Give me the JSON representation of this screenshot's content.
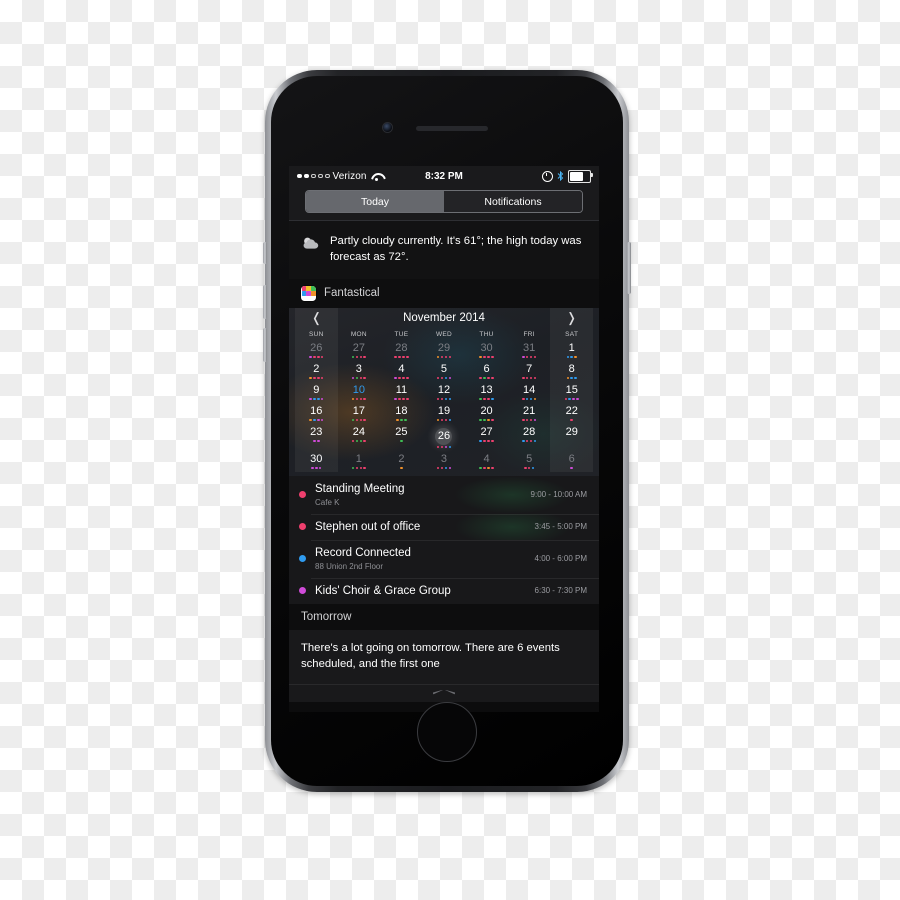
{
  "status_bar": {
    "carrier": "Verizon",
    "signal_filled": 2,
    "signal_total": 5,
    "wifi_icon": "wifi-icon",
    "time": "8:32 PM",
    "alarm_icon": "alarm-icon",
    "bluetooth_icon": "bluetooth-icon",
    "battery_icon": "battery-icon",
    "battery_level": 68
  },
  "segmented": {
    "today_label": "Today",
    "notifications_label": "Notifications",
    "selected": "Today"
  },
  "weather": {
    "icon": "partly-cloudy-icon",
    "text": "Partly cloudy currently. It's 61°; the high today was forecast as 72°."
  },
  "fantastical": {
    "app_icon": "fantastical-icon",
    "title": "Fantastical",
    "calendar": {
      "prev_label": "❬",
      "next_label": "❭",
      "month_label": "November 2014",
      "weekdays": [
        "SUN",
        "MON",
        "TUE",
        "WED",
        "THU",
        "FRI",
        "SAT"
      ],
      "today": 26,
      "highlight_blue": 10,
      "weeks": [
        [
          {
            "n": "26",
            "dim": true,
            "dots": [
              "#cf4bd8",
              "#ef3f6e",
              "#ef3f6e",
              "#ef3f6e"
            ]
          },
          {
            "n": "27",
            "dim": true,
            "dots": [
              "#3fbf55",
              "#ef3f6e",
              "#ef3f6e",
              "#ef3f6e"
            ]
          },
          {
            "n": "28",
            "dim": true,
            "dots": [
              "#ef3f6e",
              "#ef3f6e",
              "#ef3f6e",
              "#ef3f6e"
            ]
          },
          {
            "n": "29",
            "dim": true,
            "dots": [
              "#f0902a",
              "#ef3f6e",
              "#ef3f6e",
              "#ef3f6e"
            ]
          },
          {
            "n": "30",
            "dim": true,
            "dots": [
              "#f0902a",
              "#ef3f6e",
              "#ef3f6e",
              "#ef3f6e"
            ]
          },
          {
            "n": "31",
            "dim": true,
            "dots": [
              "#cf4bd8",
              "#ef3f6e",
              "#ef3f6e",
              "#ef3f6e"
            ]
          },
          {
            "n": "1",
            "dim": false,
            "dots": [
              "#2f9bef",
              "#2f9bef",
              "#f0902a"
            ]
          }
        ],
        [
          {
            "n": "2",
            "dim": false,
            "dots": [
              "#f0902a",
              "#ef3f6e",
              "#ef3f6e",
              "#ef3f6e"
            ]
          },
          {
            "n": "3",
            "dim": false,
            "dots": [
              "#cf4bd8",
              "#3fbf55",
              "#ef3f6e",
              "#ef3f6e"
            ]
          },
          {
            "n": "4",
            "dim": false,
            "dots": [
              "#cf4bd8",
              "#ef3f6e",
              "#ef3f6e",
              "#ef3f6e"
            ]
          },
          {
            "n": "5",
            "dim": false,
            "dots": [
              "#ef3f6e",
              "#ef3f6e",
              "#2f9bef",
              "#cf4bd8"
            ]
          },
          {
            "n": "6",
            "dim": false,
            "dots": [
              "#ef3f6e",
              "#3fbf55",
              "#ef3f6e",
              "#ef3f6e"
            ]
          },
          {
            "n": "7",
            "dim": false,
            "dots": [
              "#ef3f6e",
              "#ef3f6e",
              "#ef3f6e",
              "#ef3f6e"
            ]
          },
          {
            "n": "8",
            "dim": false,
            "dots": [
              "#f0902a",
              "#2f9bef",
              "#2f9bef"
            ]
          }
        ],
        [
          {
            "n": "9",
            "dim": false,
            "dots": [
              "#cf4bd8",
              "#2f9bef",
              "#2f9bef",
              "#cf4bd8"
            ]
          },
          {
            "n": "10",
            "dim": false,
            "blue": true,
            "dots": [
              "#f0902a",
              "#ef3f6e",
              "#ef3f6e",
              "#ef3f6e"
            ]
          },
          {
            "n": "11",
            "dim": false,
            "dots": [
              "#cf4bd8",
              "#ef3f6e",
              "#ef3f6e",
              "#ef3f6e"
            ]
          },
          {
            "n": "12",
            "dim": false,
            "dots": [
              "#ef3f6e",
              "#ef3f6e",
              "#2f9bef",
              "#2f9bef"
            ]
          },
          {
            "n": "13",
            "dim": false,
            "dots": [
              "#3fbf55",
              "#ef3f6e",
              "#ef3f6e",
              "#2f9bef"
            ]
          },
          {
            "n": "14",
            "dim": false,
            "dots": [
              "#ef3f6e",
              "#2f9bef",
              "#2f9bef",
              "#f0902a"
            ]
          },
          {
            "n": "15",
            "dim": false,
            "dots": [
              "#ef3f6e",
              "#2f9bef",
              "#cf4bd8",
              "#cf4bd8"
            ]
          }
        ],
        [
          {
            "n": "16",
            "dim": false,
            "dots": [
              "#f0902a",
              "#2f9bef",
              "#cf4bd8",
              "#cf4bd8"
            ]
          },
          {
            "n": "17",
            "dim": false,
            "dots": [
              "#3fbf55",
              "#ef3f6e",
              "#ef3f6e",
              "#ef3f6e"
            ]
          },
          {
            "n": "18",
            "dim": false,
            "dots": [
              "#f0902a",
              "#3fbf55",
              "#3fbf55"
            ]
          },
          {
            "n": "19",
            "dim": false,
            "dots": [
              "#f0902a",
              "#ef3f6e",
              "#ef3f6e",
              "#2f9bef"
            ]
          },
          {
            "n": "20",
            "dim": false,
            "dots": [
              "#3fbf55",
              "#3fbf55",
              "#f0902a",
              "#ef3f6e"
            ]
          },
          {
            "n": "21",
            "dim": false,
            "dots": [
              "#ef3f6e",
              "#ef3f6e",
              "#ef3f6e",
              "#cf4bd8"
            ]
          },
          {
            "n": "22",
            "dim": false,
            "dots": [
              "#ef3f6e"
            ]
          }
        ],
        [
          {
            "n": "23",
            "dim": false,
            "dots": [
              "#cf4bd8",
              "#cf4bd8"
            ]
          },
          {
            "n": "24",
            "dim": false,
            "dots": [
              "#ef3f6e",
              "#3fbf55",
              "#3fbf55",
              "#ef3f6e"
            ]
          },
          {
            "n": "25",
            "dim": false,
            "dots": [
              "#3fbf55"
            ]
          },
          {
            "n": "26",
            "dim": false,
            "today": true,
            "dots": [
              "#ef3f6e",
              "#ef3f6e",
              "#cf4bd8",
              "#2f9bef"
            ]
          },
          {
            "n": "27",
            "dim": false,
            "dots": [
              "#2f9bef",
              "#ef3f6e",
              "#ef3f6e",
              "#ef3f6e"
            ]
          },
          {
            "n": "28",
            "dim": false,
            "dots": [
              "#2f9bef",
              "#ef3f6e",
              "#ef3f6e",
              "#2f9bef"
            ]
          },
          {
            "n": "29",
            "dim": false,
            "dots": []
          }
        ],
        [
          {
            "n": "30",
            "dim": false,
            "dots": [
              "#cf4bd8",
              "#cf4bd8",
              "#cf4bd8"
            ]
          },
          {
            "n": "1",
            "dim": true,
            "dots": [
              "#3fbf55",
              "#ef3f6e",
              "#ef3f6e",
              "#ef3f6e"
            ]
          },
          {
            "n": "2",
            "dim": true,
            "dots": [
              "#f0902a"
            ]
          },
          {
            "n": "3",
            "dim": true,
            "dots": [
              "#ef3f6e",
              "#ef3f6e",
              "#2f9bef",
              "#cf4bd8"
            ]
          },
          {
            "n": "4",
            "dim": true,
            "dots": [
              "#3fbf55",
              "#ef3f6e",
              "#f0902a",
              "#ef3f6e"
            ]
          },
          {
            "n": "5",
            "dim": true,
            "dots": [
              "#ef3f6e",
              "#ef3f6e",
              "#2f9bef"
            ]
          },
          {
            "n": "6",
            "dim": true,
            "dots": [
              "#cf4bd8"
            ]
          }
        ]
      ]
    },
    "events": [
      {
        "color": "#ef3f6e",
        "title": "Standing Meeting",
        "subtitle": "Cafe K",
        "time": "9:00 - 10:00 AM"
      },
      {
        "color": "#ef3f6e",
        "title": "Stephen out of office",
        "subtitle": "",
        "time": "3:45 - 5:00 PM"
      },
      {
        "color": "#2f9bef",
        "title": "Record Connected",
        "subtitle": "88 Union 2nd Floor",
        "time": "4:00 - 6:00 PM"
      },
      {
        "color": "#cf4bd8",
        "title": "Kids' Choir & Grace Group",
        "subtitle": "",
        "time": "6:30 - 7:30 PM"
      }
    ]
  },
  "tomorrow": {
    "header": "Tomorrow",
    "body": "There's a lot going on tomorrow. There are 6 events scheduled, and the first one"
  },
  "colors": {
    "accent_pink": "#ef3f6e",
    "accent_blue": "#2f9bef",
    "accent_purple": "#cf4bd8",
    "accent_green": "#3fbf55",
    "accent_orange": "#f0902a",
    "fantastical_red": "#ef3f3c"
  }
}
